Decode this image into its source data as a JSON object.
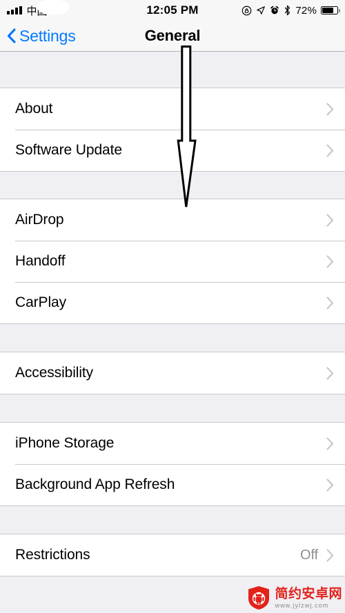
{
  "status_bar": {
    "carrier": "中国",
    "signal_icon": "cellular-signal-icon",
    "wifi_icon": "wifi-icon",
    "time": "12:05 PM",
    "rotation_lock_icon": "rotation-lock-icon",
    "location_icon": "location-arrow-icon",
    "alarm_icon": "alarm-clock-icon",
    "bluetooth_icon": "bluetooth-icon",
    "battery_percent": "72%",
    "battery_level": 72,
    "battery_icon": "battery-icon"
  },
  "nav_bar": {
    "back_label": "Settings",
    "back_icon": "chevron-left-icon",
    "title": "General"
  },
  "annotation": {
    "arrow_icon": "down-arrow-annotation",
    "arrow_fill": "#ffffff",
    "arrow_stroke": "#000000"
  },
  "colors": {
    "accent_blue": "#007aff",
    "group_background": "#efeff4",
    "row_background": "#ffffff",
    "separator": "#c8c7cc",
    "chevron": "#c7c7cc",
    "value_text": "#8e8e93",
    "watermark_red": "#e2231a"
  },
  "list": {
    "groups": [
      {
        "rows": [
          {
            "label": "About",
            "value": "",
            "accessory": "chevron-right-icon"
          },
          {
            "label": "Software Update",
            "value": "",
            "accessory": "chevron-right-icon"
          }
        ]
      },
      {
        "rows": [
          {
            "label": "AirDrop",
            "value": "",
            "accessory": "chevron-right-icon"
          },
          {
            "label": "Handoff",
            "value": "",
            "accessory": "chevron-right-icon"
          },
          {
            "label": "CarPlay",
            "value": "",
            "accessory": "chevron-right-icon"
          }
        ]
      },
      {
        "rows": [
          {
            "label": "Accessibility",
            "value": "",
            "accessory": "chevron-right-icon"
          }
        ]
      },
      {
        "rows": [
          {
            "label": "iPhone Storage",
            "value": "",
            "accessory": "chevron-right-icon"
          },
          {
            "label": "Background App Refresh",
            "value": "",
            "accessory": "chevron-right-icon"
          }
        ]
      },
      {
        "rows": [
          {
            "label": "Restrictions",
            "value": "Off",
            "accessory": "chevron-right-icon"
          }
        ]
      }
    ]
  },
  "watermark": {
    "site_name": "简约安卓网",
    "url": "www.jylzwj.com",
    "logo_icon": "android-shield-logo"
  }
}
